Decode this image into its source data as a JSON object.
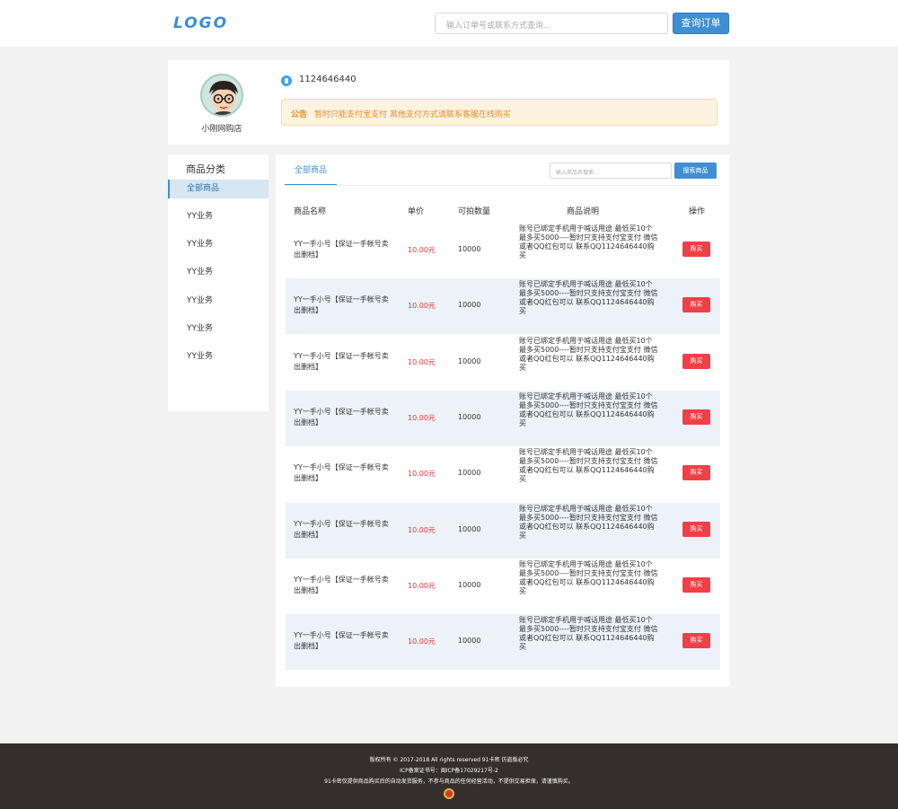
{
  "header": {
    "logo": "LOGO",
    "search_placeholder": "输入订单号或联系方式查询...",
    "search_button": "查询订单"
  },
  "shop": {
    "name": "小刚网购店",
    "qq": "1124646440",
    "notice_label": "公告",
    "notice_text": "暂时只能支付宝支付 其他支付方式请联系客服在线购买"
  },
  "sidebar": {
    "title": "商品分类",
    "items": [
      {
        "label": "全部商品"
      },
      {
        "label": "YY业务"
      },
      {
        "label": "YY业务"
      },
      {
        "label": "YY业务"
      },
      {
        "label": "YY业务"
      },
      {
        "label": "YY业务"
      },
      {
        "label": "YY业务"
      }
    ]
  },
  "main": {
    "tab": "全部商品",
    "search_placeholder": "输入商品名搜索...",
    "search_button": "搜索商品",
    "columns": [
      "商品名称",
      "单价",
      "可拍数量",
      "商品说明",
      "操作"
    ],
    "rows": [
      {
        "name": "YY一手小号【保证一手帐号卖出删档】",
        "price": "10.00元",
        "qty": "10000",
        "desc": "账号已绑定手机用于喊话用途  最低买10个 最多买5000----暂时只支持支付宝支付 微信或者QQ红包可以 联系QQ1124646440购买",
        "action": "购买"
      },
      {
        "name": "YY一手小号【保证一手帐号卖出删档】",
        "price": "10.00元",
        "qty": "10000",
        "desc": "账号已绑定手机用于喊话用途  最低买10个 最多买5000----暂时只支持支付宝支付 微信或者QQ红包可以 联系QQ1124646440购买",
        "action": "购买"
      },
      {
        "name": "YY一手小号【保证一手帐号卖出删档】",
        "price": "10.00元",
        "qty": "10000",
        "desc": "账号已绑定手机用于喊话用途  最低买10个 最多买5000----暂时只支持支付宝支付 微信或者QQ红包可以 联系QQ1124646440购买",
        "action": "购买"
      },
      {
        "name": "YY一手小号【保证一手帐号卖出删档】",
        "price": "10.00元",
        "qty": "10000",
        "desc": "账号已绑定手机用于喊话用途  最低买10个 最多买5000----暂时只支持支付宝支付 微信或者QQ红包可以 联系QQ1124646440购买",
        "action": "购买"
      },
      {
        "name": "YY一手小号【保证一手帐号卖出删档】",
        "price": "10.00元",
        "qty": "10000",
        "desc": "账号已绑定手机用于喊话用途  最低买10个 最多买5000----暂时只支持支付宝支付 微信或者QQ红包可以 联系QQ1124646440购买",
        "action": "购买"
      },
      {
        "name": "YY一手小号【保证一手帐号卖出删档】",
        "price": "10.00元",
        "qty": "10000",
        "desc": "账号已绑定手机用于喊话用途  最低买10个 最多买5000----暂时只支持支付宝支付 微信或者QQ红包可以 联系QQ1124646440购买",
        "action": "购买"
      },
      {
        "name": "YY一手小号【保证一手帐号卖出删档】",
        "price": "10.00元",
        "qty": "10000",
        "desc": "账号已绑定手机用于喊话用途  最低买10个 最多买5000----暂时只支持支付宝支付 微信或者QQ红包可以 联系QQ1124646440购买",
        "action": "购买"
      },
      {
        "name": "YY一手小号【保证一手帐号卖出删档】",
        "price": "10.00元",
        "qty": "10000",
        "desc": "账号已绑定手机用于喊话用途  最低买10个 最多买5000----暂时只支持支付宝支付 微信或者QQ红包可以 联系QQ1124646440购买",
        "action": "购买"
      }
    ]
  },
  "footer": {
    "copyright": "版权所有 © 2017-2018 All rights reserved 91卡密 仿盗版必究",
    "icp": "ICP备案证书号：闽ICP备17029217号-2",
    "disclaimer": "91卡密仅提供商品购买后的自动发货服务，不参与商品的任何经营活动，不提供交易担保，请谨慎购买。"
  },
  "colors": {
    "accent": "#3f8fd2",
    "buy_button": "#ee4047",
    "price": "#e23535",
    "notice_text": "#ef8a1c",
    "footer_bg": "#342f2c"
  },
  "icons": {
    "avatar": "cartoon-boy-glasses-avatar",
    "qq": "qq-penguin-icon",
    "footer_badge": "police-badge-icon"
  }
}
